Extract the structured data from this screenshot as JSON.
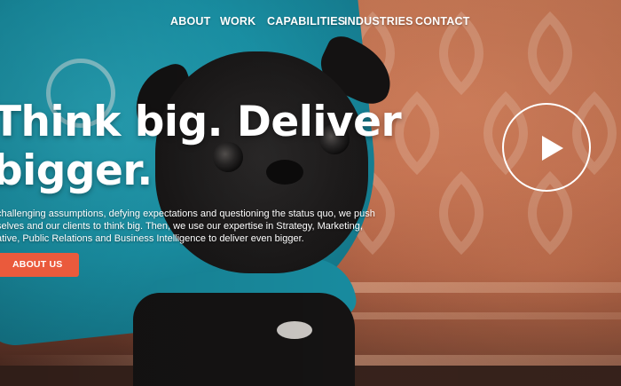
{
  "nav": {
    "items": [
      {
        "label": "ABOUT"
      },
      {
        "label": "WORK"
      },
      {
        "label": "CAPABILITIES"
      },
      {
        "label": "INDUSTRIES"
      },
      {
        "label": "CONTACT"
      }
    ]
  },
  "hero": {
    "headline_line1": "Think big. Deliver",
    "headline_line2": "bigger.",
    "body_line1": "challenging assumptions, defying expectations and questioning the status quo, we push",
    "body_line2": "selves and our clients to think big. Then, we use our expertise in Strategy, Marketing,",
    "body_line3": "ative, Public Relations and Business Intelligence to deliver even bigger.",
    "cta_label": "ABOUT US",
    "play_icon": "play-icon"
  },
  "colors": {
    "accent": "#ea5a3c",
    "shirt": "#1c9db3",
    "text": "#ffffff"
  }
}
